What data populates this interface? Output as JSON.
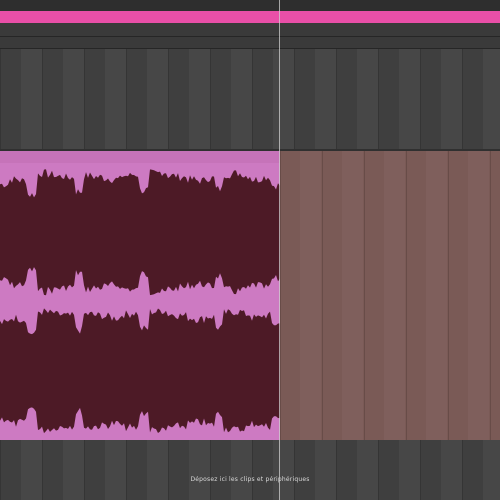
{
  "colors": {
    "background": "#4a4a4a",
    "loop_bar": "#e94fa8",
    "clip_header": "#c673b9",
    "clip_body": "#cd7ac2",
    "waveform": "#4d1a26",
    "ghost_region": "#7a5a56",
    "grid_dark": "#3f3f3f",
    "grid_light": "#555555",
    "playhead": "#cfcfcf"
  },
  "arrangement": {
    "drop_hint": "Déposez ici les clips et périphériques"
  },
  "waveform": {
    "channels": 2,
    "envelope_top": [
      0.72,
      0.8,
      0.78,
      0.55,
      0.9,
      0.88,
      0.85,
      0.83,
      0.6,
      0.86,
      0.84,
      0.82,
      0.8,
      0.86,
      0.88,
      0.62,
      0.9,
      0.92,
      0.86,
      0.84,
      0.8,
      0.78,
      0.82,
      0.64,
      0.88,
      0.9,
      0.86,
      0.8,
      0.84,
      0.7
    ],
    "icons": []
  }
}
